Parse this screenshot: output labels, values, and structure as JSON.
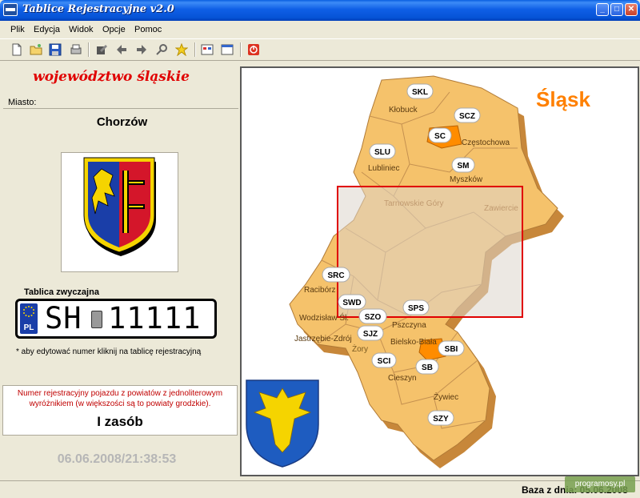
{
  "window": {
    "title": "Tablice Rejestracyjne v2.0",
    "controls": {
      "minimize": "_",
      "maximize": "□",
      "close": "✕"
    }
  },
  "menu": {
    "items": [
      "Plik",
      "Edycja",
      "Widok",
      "Opcje",
      "Pomoc"
    ]
  },
  "toolbar": {
    "icons": [
      "new-icon",
      "open-folder-icon",
      "save-icon",
      "print-icon",
      "edit-icon",
      "back-arrow-icon",
      "forward-arrow-icon",
      "search-icon",
      "star-icon",
      "grid-view-icon",
      "list-view-icon",
      "exit-icon"
    ]
  },
  "left": {
    "voivodeship": "województwo śląskie",
    "city_label": "Miasto:",
    "city": "Chorzów",
    "plate_caption": "Tablica zwyczajna",
    "plate": {
      "country": "PL",
      "prefix": "SH",
      "number": "11111"
    },
    "plate_note": "* aby edytować numer kliknij na tablicę rejestracyjną",
    "zasob_description": "Numer rejestracyjny pojazdu z powiatów z jednoliterowym wyróżnikiem (w większości są to powiaty grodzkie).",
    "zasob_value": "I zasób",
    "datetime": "06.06.2008/21:38:53"
  },
  "map": {
    "region_title": "Śląsk",
    "codes": [
      {
        "code": "SKL",
        "town": "Kłobuck"
      },
      {
        "code": "SCZ",
        "town": ""
      },
      {
        "code": "SC",
        "town": "Częstochowa"
      },
      {
        "code": "SLU",
        "town": "Lubliniec"
      },
      {
        "code": "SM",
        "town": "Myszków"
      },
      {
        "code": "SRC",
        "town": "Racibórz"
      },
      {
        "code": "SWD",
        "town": "Wodzisław Śl."
      },
      {
        "code": "SZO",
        "town": ""
      },
      {
        "code": "SPS",
        "town": "Pszczyna"
      },
      {
        "code": "SJZ",
        "town": "Jastrzębie-Zdrój"
      },
      {
        "code": "SBI",
        "town": "Bielsko-Biała"
      },
      {
        "code": "SCI",
        "town": "Cieszyn"
      },
      {
        "code": "SB",
        "town": ""
      },
      {
        "code": "SZY",
        "town": "Żywiec"
      }
    ],
    "extra_labels": {
      "tarnowskie": "Tarnowskie Góry",
      "zawiercie": "Zawiercie",
      "zory": "Żory"
    },
    "colors": {
      "land": "#f5c26b",
      "shadow": "#c7873a",
      "highlight": "#ff8c00",
      "selection": "#e00000"
    }
  },
  "status": {
    "text": "Baza z dnia: 05.06.2008",
    "watermark": "programosy.pl"
  }
}
